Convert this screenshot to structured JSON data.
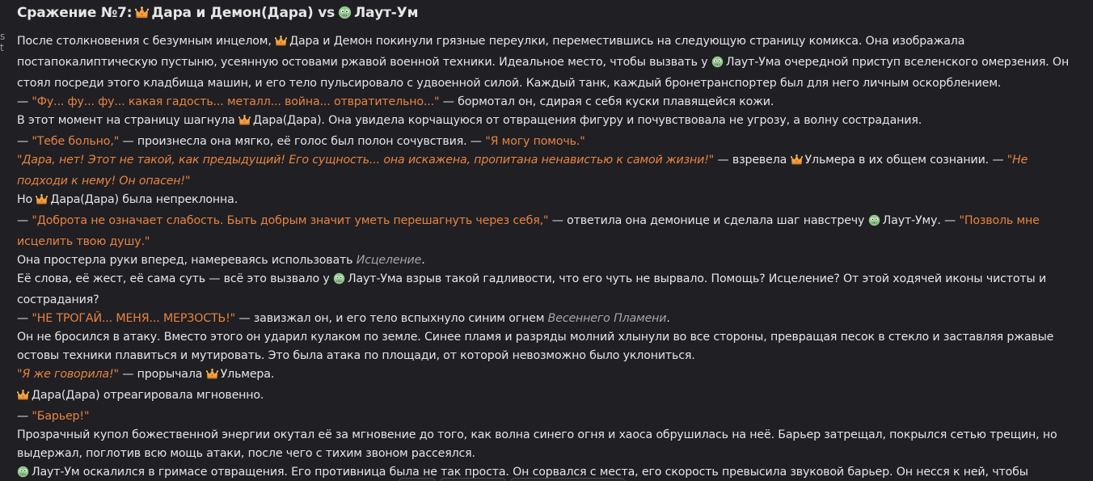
{
  "gutter": {
    "chars": [
      "s",
      "t"
    ]
  },
  "title": {
    "prefix": "Сражение №7:",
    "icon_a": "crown-icon",
    "side_a": "Дара и Демон(Дара)",
    "vs": "vs",
    "icon_b": "zombie-face-icon",
    "side_b": "Лаут-Ум"
  },
  "story": {
    "p1_a": "После столкновения с безумным инцелом, ",
    "p1_b": "Дара и Демон покинули грязные переулки, переместившись на следующую страницу комикса. Она изображала постапокалиптическую пустыню, усеянную остовами ржавой военной техники. Идеальное место, чтобы вызвать у ",
    "p1_c": "Лаут-Ума очередной приступ вселенского омерзения. Он стоял посреди этого кладбища машин, и его тело пульсировало с удвоенной силой. Каждый танк, каждый бронетранспортер был для него личным оскорблением.",
    "p2_dash": "— ",
    "p2_quote": "\"Фу... фу... фу... какая гадость... металл... война... отвратительно...\"",
    "p2_rest": " — бормотал он, сдирая с себя куски плавящейся кожи.",
    "p3_a": "В этот момент на страницу шагнула ",
    "p3_b": "Дара(Дара). Она увидела корчащуюся от отвращения фигуру и почувствовала не угрозу, а волну сострадания.",
    "p4_dash": "— ",
    "p4_q1": "\"Тебе больно,\"",
    "p4_mid": " — произнесла она мягко, её голос был полон сочувствия. — ",
    "p4_q2": "\"Я могу помочь.\"",
    "p5_q1": "\"Дара, нет! Этот не такой, как предыдущий! Его сущность... она искажена, пропитана ненавистью к самой жизни!\"",
    "p5_mid": " — взревела ",
    "p5_name": "Ульмера в их общем сознании. — ",
    "p5_q2": "\"Не подходи к нему! Он опасен!\"",
    "p6_a": "Но ",
    "p6_b": "Дара(Дара) была непреклонна.",
    "p7_dash": "— ",
    "p7_q1": "\"Доброта не означает слабость. Быть добрым значит уметь перешагнуть через себя,\"",
    "p7_mid": " — ответила она демонице и сделала шаг навстречу ",
    "p7_name": "Лаут-Уму. — ",
    "p7_q2": "\"Позволь мне исцелить твою душу.\"",
    "p8_a": "Она простерла руки вперед, намереваясь использовать ",
    "p8_spell": "Исцеление",
    "p8_end": ".",
    "p9_a": "Её слова, её жест, её сама суть — всё это вызвало у ",
    "p9_b": "Лаут-Ума взрыв такой гадливости, что его чуть не вырвало. Помощь? Исцеление? От этой ходячей иконы чистоты и сострадания?",
    "p10_dash": "— ",
    "p10_q": "\"НЕ ТРОГАЙ... МЕНЯ... МЕРЗОСТЬ!\"",
    "p10_mid": " — завизжал он, и его тело вспыхнуло синим огнем ",
    "p10_spell": "Весеннего Пламени",
    "p10_end": ".",
    "p11": "Он не бросился в атаку. Вместо этого он ударил кулаком по земле. Синее пламя и разряды молний хлынули во все стороны, превращая песок в стекло и заставляя ржавые остовы техники плавиться и мутировать. Это была атака по площади, от которой невозможно было уклониться.",
    "p12_q": "\"Я же говорила!\"",
    "p12_mid": " — прорычала ",
    "p12_name": "Ульмера.",
    "p13": "Дара(Дара) отреагировала мгновенно.",
    "p14_dash": "— ",
    "p14_q": "\"Барьер!\"",
    "p15": "Прозрачный купол божественной энергии окутал её за мгновение до того, как волна синего огня и хаоса обрушилась на неё. Барьер затрещал, покрылся сетью трещин, но выдержал, поглотив всю мощь атаки, после чего с тихим звоном рассеялся.",
    "p16": "Лаут-Ум оскалился в гримасе отвращения. Его противница была не так проста. Он сорвался с места, его скорость превысила звуковой барьер. Он несся к ней, чтобы закончить всё одним касанием."
  },
  "colors": {
    "background": "#1f1f24",
    "text": "#e6e6e6",
    "quote": "#e8843f",
    "spell": "#a5a5ab"
  }
}
